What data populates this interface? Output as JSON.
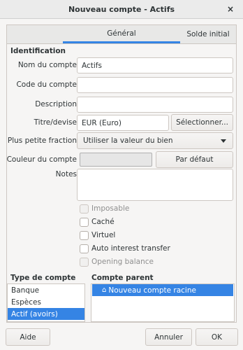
{
  "window": {
    "title": "Nouveau compte - Actifs",
    "close_symbol": "×"
  },
  "tabs": [
    {
      "label": "Général",
      "active": true
    },
    {
      "label": "Solde initial",
      "active": false
    }
  ],
  "identification": {
    "section_title": "Identification",
    "name_label": "Nom du compte",
    "name_value": "Actifs",
    "code_label": "Code du compte",
    "code_value": "",
    "description_label": "Description",
    "description_value": "",
    "currency_label": "Titre/devise",
    "currency_value": "EUR (Euro)",
    "select_button": "Sélectionner...",
    "fraction_label": "Plus petite fraction",
    "fraction_value": "Utiliser la valeur du bien",
    "color_label": "Couleur du compte",
    "default_button": "Par défaut",
    "notes_label": "Notes",
    "notes_value": ""
  },
  "checkboxes": [
    {
      "label": "Imposable",
      "checked": false,
      "enabled": false
    },
    {
      "label": "Caché",
      "checked": false,
      "enabled": true
    },
    {
      "label": "Virtuel",
      "checked": false,
      "enabled": true
    },
    {
      "label": "Auto interest transfer",
      "checked": false,
      "enabled": true
    },
    {
      "label": "Opening balance",
      "checked": false,
      "enabled": false
    }
  ],
  "account_type": {
    "title": "Type de compte",
    "items": [
      "Banque",
      "Espèces",
      "Actif (avoirs)"
    ],
    "selected_index": 2
  },
  "parent_account": {
    "title": "Compte parent",
    "root_label": "Nouveau compte racine",
    "icon": "home-icon"
  },
  "buttons": {
    "help": "Aide",
    "cancel": "Annuler",
    "ok": "OK"
  },
  "colors": {
    "accent": "#3584e4"
  }
}
